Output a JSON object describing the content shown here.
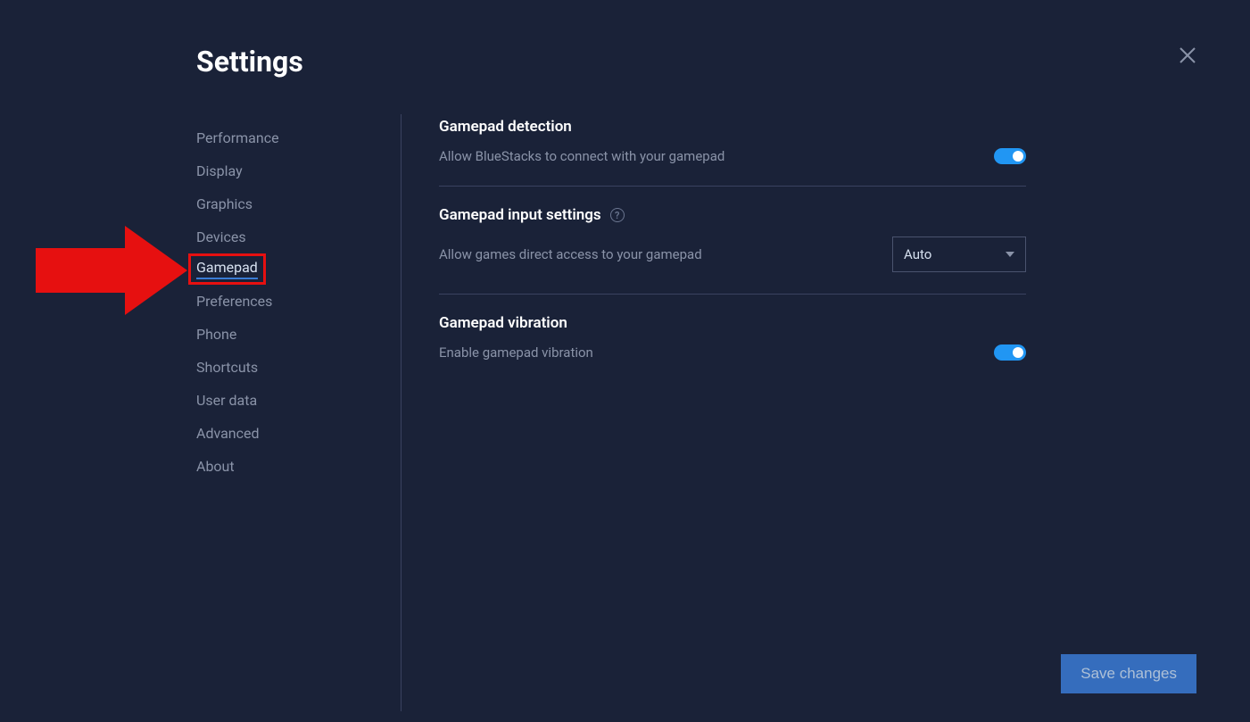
{
  "page_title": "Settings",
  "sidebar": {
    "items": [
      {
        "label": "Performance"
      },
      {
        "label": "Display"
      },
      {
        "label": "Graphics"
      },
      {
        "label": "Devices"
      },
      {
        "label": "Gamepad"
      },
      {
        "label": "Preferences"
      },
      {
        "label": "Phone"
      },
      {
        "label": "Shortcuts"
      },
      {
        "label": "User data"
      },
      {
        "label": "Advanced"
      },
      {
        "label": "About"
      }
    ],
    "active_index": 4
  },
  "sections": {
    "detection": {
      "title": "Gamepad detection",
      "description": "Allow BlueStacks to connect with your gamepad",
      "toggle_on": true
    },
    "input": {
      "title": "Gamepad input settings",
      "description": "Allow games direct access to your gamepad",
      "dropdown_value": "Auto"
    },
    "vibration": {
      "title": "Gamepad vibration",
      "description": "Enable gamepad vibration",
      "toggle_on": true
    }
  },
  "buttons": {
    "save": "Save changes"
  },
  "help_symbol": "?"
}
